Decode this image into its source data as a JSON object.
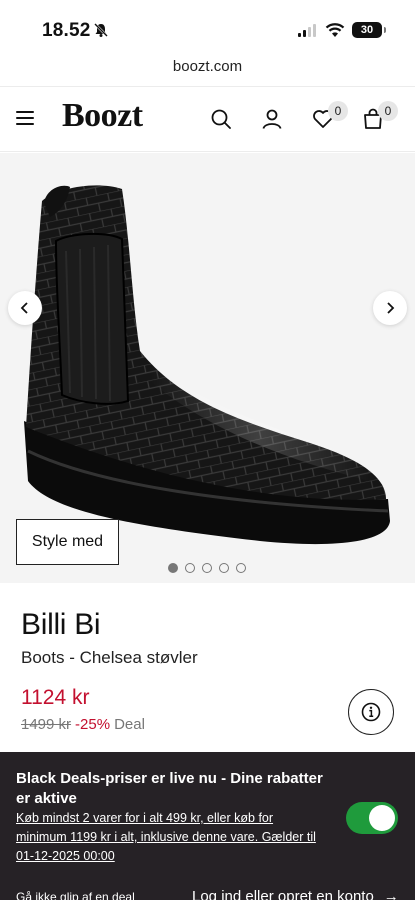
{
  "status_bar": {
    "time": "18.52",
    "battery": "30"
  },
  "browser": {
    "url": "boozt.com"
  },
  "header": {
    "logo": "Boozt",
    "wishlist_count": "0",
    "cart_count": "0"
  },
  "gallery": {
    "style_button_label": "Style med",
    "slide_count": 5,
    "active_slide": 1
  },
  "product": {
    "brand": "Billi Bi",
    "category": "Boots - Chelsea støvler",
    "price": "1124 kr",
    "old_price": "1499 kr",
    "discount": "-25%",
    "deal_label": "Deal"
  },
  "banner": {
    "title": "Black Deals-priser er live nu - Dine rabatter er aktive",
    "body": "Køb mindst 2 varer for i alt 499 kr, eller køb for minimum 1199 kr i alt, inklusive denne vare. Gælder til 01-12-2025 00:00",
    "toggle_on": true,
    "bottom_left": "Gå ikke glip af en deal",
    "bottom_right": "Log ind eller opret en konto",
    "bottom_right_arrow": "→"
  },
  "colors": {
    "sale_red": "#c3102f",
    "banner_bg": "#262226",
    "toggle_green": "#1f9b3c"
  }
}
